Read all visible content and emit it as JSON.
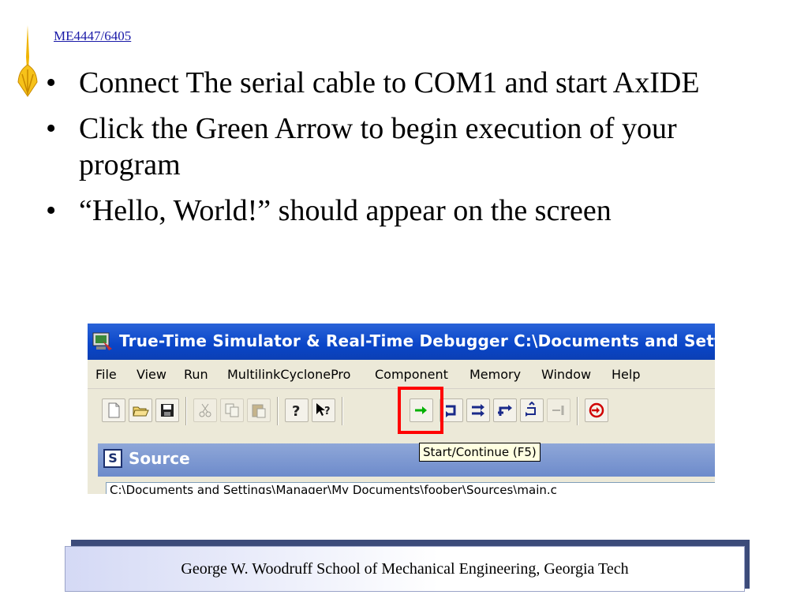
{
  "slide": {
    "course": "ME4447/6405",
    "bullets": [
      "Connect The serial cable to COM1 and start AxIDE",
      "Click the Green Arrow to begin execution of your program",
      "“Hello, World!” should appear on the screen"
    ],
    "bullet_glyph": "•",
    "footer": "George W. Woodruff School of Mechanical Engineering, Georgia Tech"
  },
  "screenshot": {
    "title": "True-Time Simulator & Real-Time Debugger   C:\\Documents and Sett",
    "menu": [
      "File",
      "View",
      "Run",
      "MultilinkCyclonePro",
      "Component",
      "Memory",
      "Window",
      "Help"
    ],
    "toolbar_icons": [
      "new-file-icon",
      "open-folder-icon",
      "save-icon",
      "cut-icon",
      "copy-icon",
      "paste-icon",
      "help-icon",
      "context-help-icon",
      "start-continue-icon",
      "single-step-icon",
      "step-over-icon",
      "step-out-icon",
      "assembly-step-icon",
      "halt-icon",
      "reset-icon"
    ],
    "tooltip": "Start/Continue (F5)",
    "panel_title": "Source",
    "panel_icon_letter": "S",
    "path": "C:\\Documents and Settings\\Manager\\My Documents\\foober\\Sources\\main.c",
    "colors": {
      "titlebar": "#0a46c8",
      "highlight": "#ff0000",
      "green_arrow": "#00b000",
      "tooltip_bg": "#ffffe1"
    }
  }
}
